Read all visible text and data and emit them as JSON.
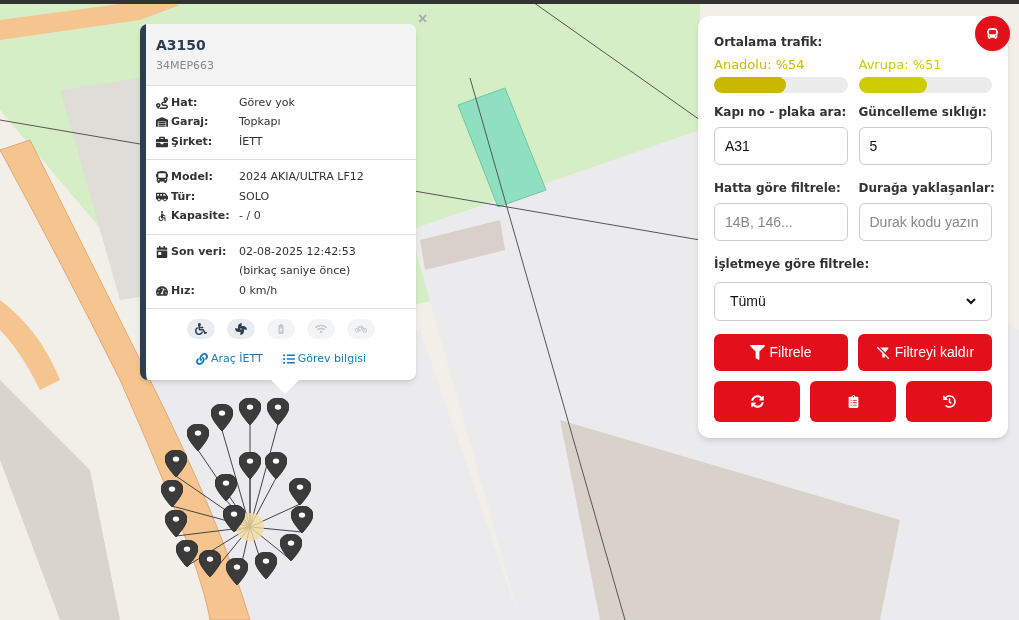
{
  "popup": {
    "title": "A3150",
    "plate": "34MEP663",
    "close": "×",
    "sections": [
      [
        {
          "kind": "route",
          "label": "Hat:",
          "value": "Görev yok"
        },
        {
          "kind": "garage",
          "label": "Garaj:",
          "value": "Topkapı"
        },
        {
          "kind": "company",
          "label": "Şirket:",
          "value": "İETT"
        }
      ],
      [
        {
          "kind": "model",
          "label": "Model:",
          "value": "2024 AKIA/ULTRA LF12"
        },
        {
          "kind": "type",
          "label": "Tür:",
          "value": "SOLO"
        },
        {
          "kind": "capacity",
          "label": "Kapasite:",
          "value": "- / 0"
        }
      ],
      [
        {
          "kind": "time",
          "label": "Son veri:",
          "value": "02-08-2025 12:42:53",
          "note": "(birkaç saniye önce)"
        },
        {
          "kind": "speed",
          "label": "Hız:",
          "value": "0 km/h"
        }
      ]
    ],
    "features": [
      {
        "kind": "wheelchair",
        "on": true
      },
      {
        "kind": "fan",
        "on": true
      },
      {
        "kind": "charging",
        "on": false
      },
      {
        "kind": "wifi",
        "on": false
      },
      {
        "kind": "bike",
        "on": false
      }
    ],
    "links": [
      {
        "kind": "link",
        "label": "Araç İETT"
      },
      {
        "kind": "list",
        "label": "Görev bilgisi"
      }
    ]
  },
  "panel": {
    "traffic_title": "Ortalama trafik:",
    "traffic": [
      {
        "label": "Anadolu: %54",
        "level": 0.54,
        "color": "#c9b700"
      },
      {
        "label": "Avrupa: %51",
        "level": 0.51,
        "color": "#cccc00"
      }
    ],
    "fields": [
      {
        "label": "Kapı no - plaka ara:",
        "value": "A31"
      },
      {
        "label": "Güncelleme sıklığı:",
        "value": "5"
      },
      {
        "label": "Hatta göre filtrele:",
        "placeholder": "14B, 146..."
      },
      {
        "label": "Durağa yaklaşanlar:",
        "placeholder": "Durak kodu yazın"
      }
    ],
    "select": {
      "label": "İşletmeye göre filtrele:",
      "value": "Tümü"
    },
    "buttons": [
      {
        "kind": "filter",
        "label": "Filtrele"
      },
      {
        "kind": "unfilter",
        "label": "Filtreyi kaldır"
      }
    ],
    "icon_buttons": [
      {
        "kind": "refresh"
      },
      {
        "kind": "clipboard"
      },
      {
        "kind": "history"
      }
    ]
  }
}
